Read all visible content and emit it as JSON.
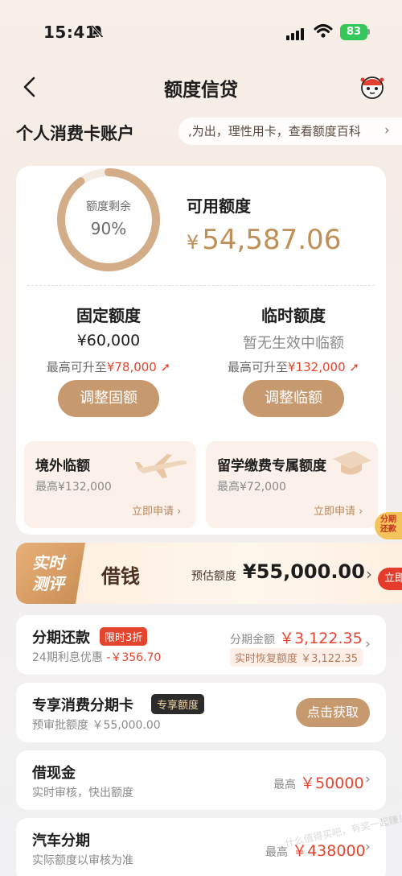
{
  "status_bar": {
    "time": "15:41",
    "battery": "83"
  },
  "nav": {
    "title": "额度信贷"
  },
  "account": {
    "title": "个人消费卡账户",
    "tip": ",为出，理性用卡，查看额度百科",
    "tip_chevron": "›"
  },
  "overview": {
    "ring_label": "额度剩余",
    "ring_percent_text": "90%",
    "ring_fraction": 0.9,
    "available_label": "可用额度",
    "available_currency": "¥",
    "available_amount": "54,587.06"
  },
  "fixed": {
    "title": "固定额度",
    "amount": "¥60,000",
    "hint_prefix": "最高可升至",
    "hint_value": "¥78,000",
    "button": "调整固额"
  },
  "temporary": {
    "title": "临时额度",
    "status": "暂无生效中临额",
    "hint_prefix": "最高可升至",
    "hint_value": "¥132,000",
    "button": "调整临额"
  },
  "overseas": {
    "title": "境外临额",
    "sub": "最高¥132,000",
    "link": "立即申请 ›"
  },
  "study": {
    "title": "留学缴费专属额度",
    "sub": "最高¥72,000",
    "link": "立即申请 ›"
  },
  "float_promo": {
    "line1": "分期",
    "line2": "还款"
  },
  "loan": {
    "badge_line1": "实时",
    "badge_line2": "测评",
    "title": "借钱",
    "estimate_label": "预估额度",
    "estimate_amount": "¥55,000.00",
    "apply": "立即"
  },
  "installment": {
    "title": "分期还款",
    "tag": "限时3折",
    "sub_prefix": "24期利息优惠",
    "sub_value": "-￥356.70",
    "right_label": "分期金额",
    "right_amount": "￥3,122.35",
    "restore": "实时恢复额度 ￥3,122.35"
  },
  "card_installment": {
    "title": "专享消费分期卡",
    "tag": "专享额度",
    "sub": "预审批额度 ￥55,000.00",
    "button": "点击获取"
  },
  "cash": {
    "title": "借现金",
    "sub": "实时审核，快出额度",
    "right_label": "最高",
    "right_amount": "￥50000"
  },
  "car": {
    "title": "汽车分期",
    "sub": "实际额度以审核为准",
    "right_label": "最高",
    "right_amount": "￥438000"
  },
  "watermark": "什么值得买吧，有奖一起赚！ 0ke8.com",
  "colors": {
    "gold": "#c69a6e",
    "gold_text": "#c08e57",
    "red": "#e4452e"
  }
}
